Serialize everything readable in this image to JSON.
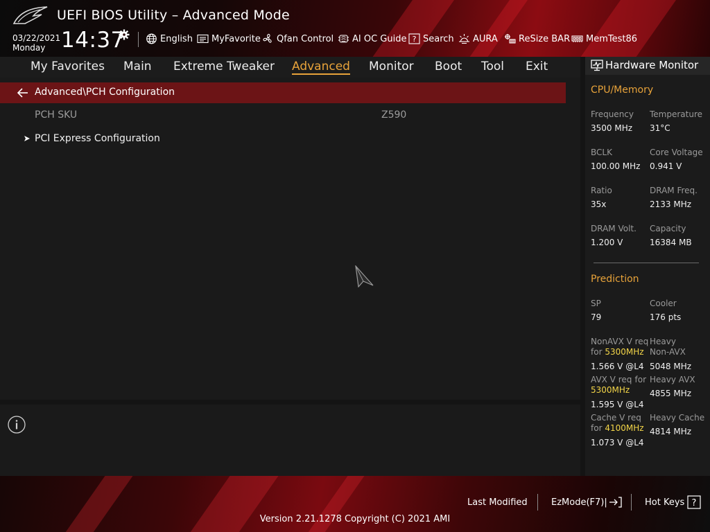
{
  "header": {
    "title": "UEFI BIOS Utility – Advanced Mode",
    "date": "03/22/2021",
    "day": "Monday",
    "time": "14:37",
    "tools": [
      {
        "label": "English",
        "icon": "globe-icon"
      },
      {
        "label": "MyFavorite",
        "icon": "favorite-list-icon"
      },
      {
        "label": "Qfan Control",
        "icon": "fan-icon"
      },
      {
        "label": "AI OC Guide",
        "icon": "ai-chip-icon"
      },
      {
        "label": "Search",
        "icon": "search-question-icon"
      },
      {
        "label": "AURA",
        "icon": "aura-light-icon"
      },
      {
        "label": "ReSize BAR",
        "icon": "resize-bar-icon"
      },
      {
        "label": "MemTest86",
        "icon": "memory-module-icon"
      }
    ]
  },
  "nav": {
    "tabs": [
      "My Favorites",
      "Main",
      "Extreme Tweaker",
      "Advanced",
      "Monitor",
      "Boot",
      "Tool",
      "Exit"
    ],
    "active": "Advanced"
  },
  "main": {
    "path": "Advanced\\PCH Configuration",
    "items": [
      {
        "label": "PCH SKU",
        "value": "Z590"
      },
      {
        "label": "PCI Express Configuration"
      }
    ]
  },
  "hardware_monitor": {
    "title": "Hardware Monitor",
    "cpu_section": "CPU/Memory",
    "cpu": [
      {
        "label": "Frequency",
        "value": "3500 MHz"
      },
      {
        "label": "Temperature",
        "value": "31°C"
      },
      {
        "label": "BCLK",
        "value": "100.00 MHz"
      },
      {
        "label": "Core Voltage",
        "value": "0.941 V"
      },
      {
        "label": "Ratio",
        "value": "35x"
      },
      {
        "label": "DRAM Freq.",
        "value": "2133 MHz"
      },
      {
        "label": "DRAM Volt.",
        "value": "1.200 V"
      },
      {
        "label": "Capacity",
        "value": "16384 MB"
      }
    ],
    "prediction_section": "Prediction",
    "prediction": {
      "sp_label": "SP",
      "sp_value": "79",
      "cooler_label": "Cooler",
      "cooler_value": "176 pts",
      "nonavx_label": "NonAVX V req",
      "nonavx_for": "for",
      "nonavx_freq": "5300MHz",
      "nonavx_value": "1.566 V @L4",
      "heavy_nonavx_label_1": "Heavy",
      "heavy_nonavx_label_2": "Non-AVX",
      "heavy_nonavx_value": "5048 MHz",
      "avx_label": "AVX V req",
      "avx_for": "for",
      "avx_freq": "5300MHz",
      "avx_value": "1.595 V @L4",
      "heavy_avx_label": "Heavy AVX",
      "heavy_avx_value": "4855 MHz",
      "cache_label": "Cache V req",
      "cache_for": "for",
      "cache_freq": "4100MHz",
      "cache_value": "1.073 V @L4",
      "heavy_cache_label": "Heavy Cache",
      "heavy_cache_value": "4814 MHz"
    }
  },
  "footer": {
    "last_modified": "Last Modified",
    "ezmode": "EzMode(F7)|",
    "hot_keys": "Hot Keys",
    "version": "Version 2.21.1278 Copyright (C) 2021 AMI"
  },
  "colors": {
    "accent": "#e8a33a",
    "highlight": "#f3d548",
    "path_bar": "#6c1416",
    "brand_red": "#8c0c12"
  }
}
